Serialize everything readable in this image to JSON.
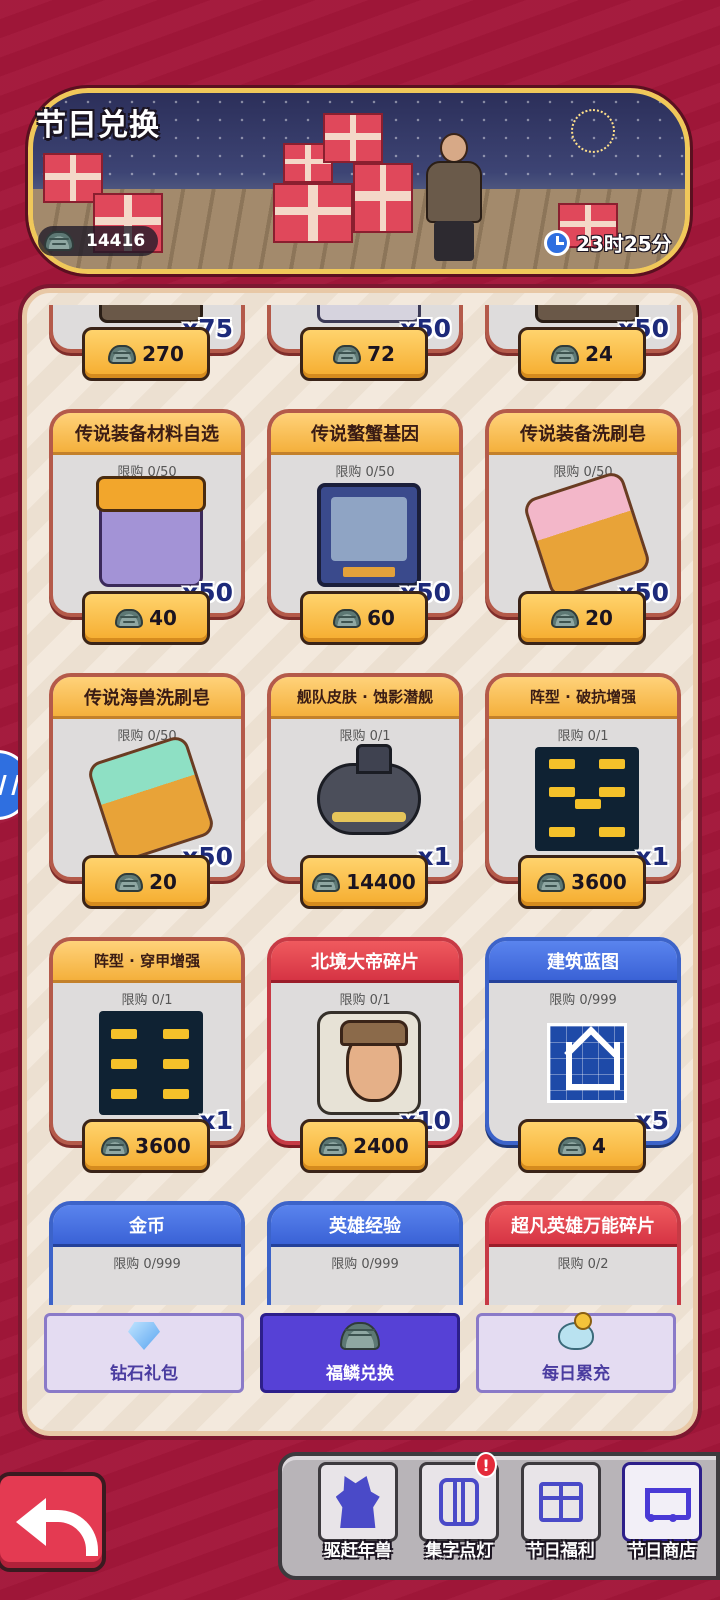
{
  "header": {
    "title": "节日兑换",
    "currency_value": "14416",
    "timer": "23时25分"
  },
  "shop": {
    "items": [
      {
        "name": "",
        "limit": "",
        "qty": "x75",
        "price": "270",
        "style": "gold",
        "art": "crate"
      },
      {
        "name": "",
        "limit": "",
        "qty": "x50",
        "price": "72",
        "style": "gold",
        "art": "crate2"
      },
      {
        "name": "",
        "limit": "",
        "qty": "x50",
        "price": "24",
        "style": "gold",
        "art": "crate"
      },
      {
        "name": "传说装备材料自选",
        "limit": "限购 0/50",
        "qty": "x50",
        "price": "40",
        "style": "gold",
        "art": "box"
      },
      {
        "name": "传说螯蟹基因",
        "limit": "限购 0/50",
        "qty": "x50",
        "price": "60",
        "style": "gold",
        "art": "tv"
      },
      {
        "name": "传说装备洗刷皂",
        "limit": "限购 0/50",
        "qty": "x50",
        "price": "20",
        "style": "gold",
        "art": "soap-pink"
      },
      {
        "name": "传说海兽洗刷皂",
        "limit": "限购 0/50",
        "qty": "x50",
        "price": "20",
        "style": "gold",
        "art": "soap-green"
      },
      {
        "name": "舰队皮肤 · 蚀影潜舰",
        "limit": "限购 0/1",
        "qty": "x1",
        "price": "14400",
        "style": "gold",
        "art": "sub"
      },
      {
        "name": "阵型 · 破抗增强",
        "limit": "限购 0/1",
        "qty": "x1",
        "price": "3600",
        "style": "gold",
        "art": "formation-a"
      },
      {
        "name": "阵型 · 穿甲增强",
        "limit": "限购 0/1",
        "qty": "x1",
        "price": "3600",
        "style": "gold",
        "art": "formation-b"
      },
      {
        "name": "北境大帝碎片",
        "limit": "限购 0/1",
        "qty": "x10",
        "price": "2400",
        "style": "red",
        "art": "puzzle"
      },
      {
        "name": "建筑蓝图",
        "limit": "限购 0/999",
        "qty": "x5",
        "price": "4",
        "style": "blue",
        "art": "blueprint"
      },
      {
        "name": "金币",
        "limit": "限购 0/999",
        "qty": "",
        "price": "",
        "style": "blue",
        "art": "none"
      },
      {
        "name": "英雄经验",
        "limit": "限购 0/999",
        "qty": "",
        "price": "",
        "style": "blue",
        "art": "none"
      },
      {
        "name": "超凡英雄万能碎片",
        "limit": "限购 0/2",
        "qty": "",
        "price": "",
        "style": "red",
        "art": "none"
      }
    ]
  },
  "tabs": [
    {
      "label": "钻石礼包",
      "icon": "diamond-icon",
      "active": false
    },
    {
      "label": "福鳞兑换",
      "icon": "scale-icon",
      "active": true
    },
    {
      "label": "每日累充",
      "icon": "piggy-bank-icon",
      "active": false
    }
  ],
  "nav": [
    {
      "label": "驱赶年兽",
      "icon": "beast-icon",
      "badge": ""
    },
    {
      "label": "集字点灯",
      "icon": "lantern-icon",
      "badge": "!"
    },
    {
      "label": "节日福利",
      "icon": "gift-icon",
      "badge": ""
    },
    {
      "label": "节日商店",
      "icon": "cart-icon",
      "badge": "",
      "active": true
    }
  ],
  "colors": {
    "background": "#a3173a",
    "accent_gold": "#f5ac2e",
    "accent_purple": "#5641d6",
    "accent_blue": "#2f6fe0"
  }
}
